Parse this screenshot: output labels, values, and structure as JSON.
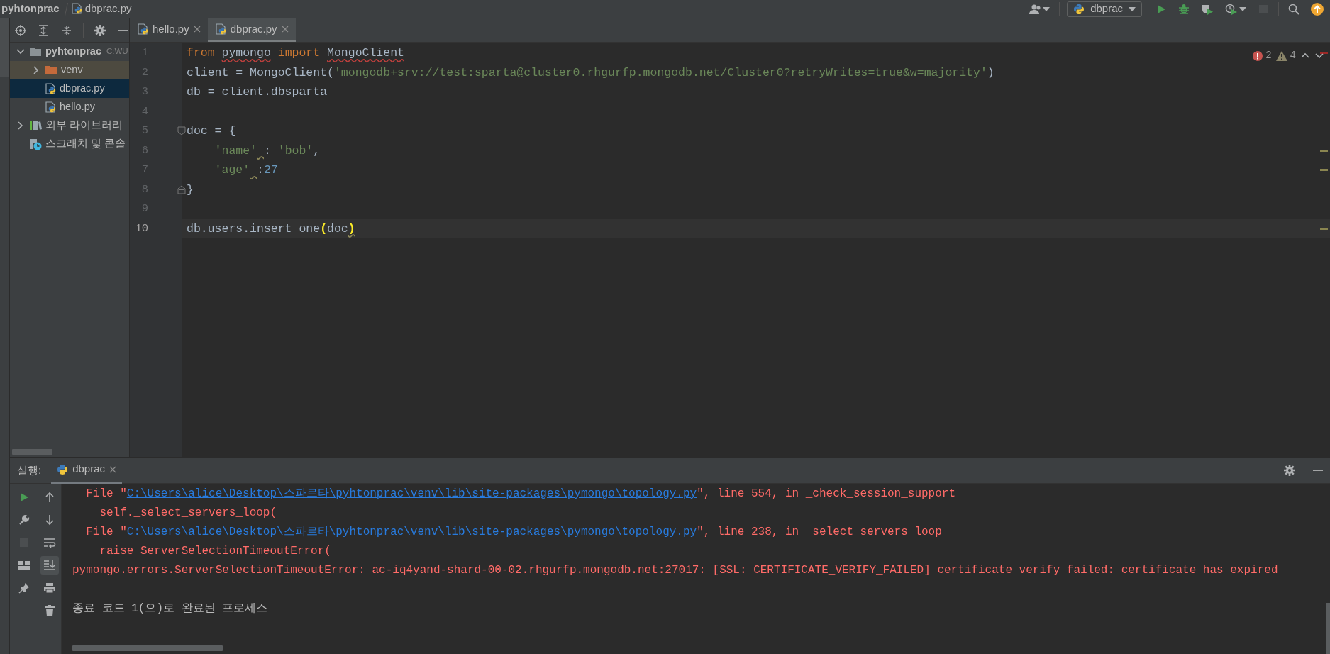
{
  "breadcrumb": [
    {
      "text": "pyhtonprac",
      "kind": "project"
    },
    {
      "text": "dbprac.py",
      "kind": "python-file"
    }
  ],
  "toolbar": {
    "run_config": "dbprac",
    "buttons": [
      {
        "kind": "account",
        "menu": true,
        "disabled": false
      },
      {
        "kind": "run",
        "menu": false,
        "disabled": false
      },
      {
        "kind": "debug",
        "menu": false,
        "disabled": false
      },
      {
        "kind": "coverage",
        "menu": false,
        "disabled": false
      },
      {
        "kind": "profile",
        "menu": true,
        "disabled": false
      },
      {
        "kind": "stop",
        "menu": false,
        "disabled": true
      },
      {
        "kind": "search",
        "menu": false,
        "disabled": false
      },
      {
        "kind": "update",
        "menu": false,
        "disabled": false
      }
    ]
  },
  "project": {
    "tools": [
      {
        "kind": "locate"
      },
      {
        "kind": "expand-all"
      },
      {
        "kind": "collapse-all"
      },
      {
        "kind": "settings"
      },
      {
        "kind": "hide"
      }
    ],
    "tree": [
      {
        "label": "pyhtonprac",
        "hint": "C:₩U",
        "kind": "project-folder",
        "expanded": true,
        "selected": false,
        "excluded": false,
        "children": [
          {
            "label": "venv",
            "kind": "excluded-folder",
            "expanded": false,
            "selected": false,
            "excluded": true
          },
          {
            "label": "dbprac.py",
            "kind": "python-file",
            "selected": true,
            "excluded": false
          },
          {
            "label": "hello.py",
            "kind": "python-file",
            "selected": false,
            "excluded": false
          }
        ]
      },
      {
        "label": "외부 라이브러리",
        "kind": "library",
        "expanded": false,
        "selected": false,
        "excluded": false
      },
      {
        "label": "스크래치 및 콘솔",
        "kind": "scratches",
        "selected": false,
        "excluded": false
      }
    ]
  },
  "editor": {
    "tabs": [
      {
        "label": "hello.py",
        "selected": false
      },
      {
        "label": "dbprac.py",
        "selected": true
      }
    ],
    "inspections": {
      "errors": "2",
      "warnings": "4"
    },
    "lines": [
      {
        "number": "1",
        "current": false,
        "stripe": {
          "kind": "error"
        },
        "tokens": [
          {
            "text": "from",
            "kind": "keyword"
          },
          {
            "text": " pymongo",
            "kind": "plain",
            "squiggle": {
              "kind": "error"
            }
          },
          {
            "text": " import",
            "kind": "keyword"
          },
          {
            "text": " MongoClient",
            "kind": "plain",
            "squiggle": {
              "kind": "error"
            }
          }
        ]
      },
      {
        "number": "2",
        "current": false,
        "tokens": [
          {
            "text": "client = MongoClient(",
            "kind": "plain"
          },
          {
            "text": "'mongodb+srv://test:sparta@cluster0.rhgurfp.mongodb.net/Cluster0?retryWrites=true&w=majority'",
            "kind": "string"
          },
          {
            "text": ")",
            "kind": "plain"
          }
        ]
      },
      {
        "number": "3",
        "current": false,
        "tokens": [
          {
            "text": "db = client.dbsparta",
            "kind": "plain"
          }
        ]
      },
      {
        "number": "4",
        "current": false
      },
      {
        "number": "5",
        "current": false,
        "fold": {
          "kind": "start"
        },
        "tokens": [
          {
            "text": "doc = {",
            "kind": "plain"
          }
        ]
      },
      {
        "number": "6",
        "current": false,
        "stripe": {
          "kind": "warning"
        },
        "tokens": [
          {
            "text": "    'name'",
            "kind": "string"
          },
          {
            "text": " : ",
            "kind": "plain",
            "squiggle": {
              "kind": "warning"
            }
          },
          {
            "text": "'bob'",
            "kind": "string"
          },
          {
            "text": ",",
            "kind": "plain"
          }
        ]
      },
      {
        "number": "7",
        "current": false,
        "stripe": {
          "kind": "warning"
        },
        "tokens": [
          {
            "text": "    'age'",
            "kind": "string"
          },
          {
            "text": " :",
            "kind": "plain",
            "squiggle": {
              "kind": "warning"
            }
          },
          {
            "text": "27",
            "kind": "number"
          }
        ]
      },
      {
        "number": "8",
        "current": false,
        "fold": {
          "kind": "end"
        },
        "tokens": [
          {
            "text": "}",
            "kind": "plain"
          }
        ]
      },
      {
        "number": "9",
        "current": false
      },
      {
        "number": "10",
        "current": true,
        "stripe": {
          "kind": "warning"
        },
        "tokens": [
          {
            "text": "db.users.insert_one",
            "kind": "plain"
          },
          {
            "text": "(",
            "kind": "brace"
          },
          {
            "text": "doc",
            "kind": "plain"
          },
          {
            "text": ")",
            "kind": "brace",
            "squiggle": {
              "kind": "warning"
            }
          }
        ]
      }
    ]
  },
  "run": {
    "label": "실행:",
    "tabs": [
      {
        "label": "dbprac",
        "selected": true
      }
    ],
    "tools": [
      {
        "kind": "run",
        "disabled": false
      },
      {
        "kind": "wrench",
        "disabled": false
      },
      {
        "kind": "stop",
        "disabled": true
      },
      {
        "kind": "layout",
        "disabled": false
      },
      {
        "kind": "pin",
        "disabled": false
      }
    ],
    "actions": [
      {
        "kind": "up",
        "on": false
      },
      {
        "kind": "down",
        "on": false
      },
      {
        "kind": "wrap",
        "on": false
      },
      {
        "kind": "scroll-end",
        "on": true
      },
      {
        "kind": "print",
        "on": false
      },
      {
        "kind": "trash",
        "on": false
      }
    ],
    "console": [
      {
        "kind": "error",
        "parts": [
          {
            "text": "  File \"",
            "link": false
          },
          {
            "text": "C:\\Users\\alice\\Desktop\\스파르타\\pyhtonprac\\venv\\lib\\site-packages\\pymongo\\topology.py",
            "link": true
          },
          {
            "text": "\", line 554, in _check_session_support",
            "link": false
          }
        ]
      },
      {
        "kind": "error",
        "parts": [
          {
            "text": "    self._select_servers_loop(",
            "link": false
          }
        ]
      },
      {
        "kind": "error",
        "parts": [
          {
            "text": "  File \"",
            "link": false
          },
          {
            "text": "C:\\Users\\alice\\Desktop\\스파르타\\pyhtonprac\\venv\\lib\\site-packages\\pymongo\\topology.py",
            "link": true
          },
          {
            "text": "\", line 238, in _select_servers_loop",
            "link": false
          }
        ]
      },
      {
        "kind": "error",
        "parts": [
          {
            "text": "    raise ServerSelectionTimeoutError(",
            "link": false
          }
        ]
      },
      {
        "kind": "error",
        "parts": [
          {
            "text": "pymongo.errors.ServerSelectionTimeoutError: ac-iq4yand-shard-00-02.rhgurfp.mongodb.net:27017: [SSL: CERTIFICATE_VERIFY_FAILED] certificate verify failed: certificate has expired",
            "link": false
          }
        ]
      },
      {
        "kind": "blank"
      },
      {
        "kind": "info",
        "parts": [
          {
            "text": "종료 코드 1(으)로 완료된 프로세스",
            "link": false
          }
        ]
      }
    ]
  }
}
